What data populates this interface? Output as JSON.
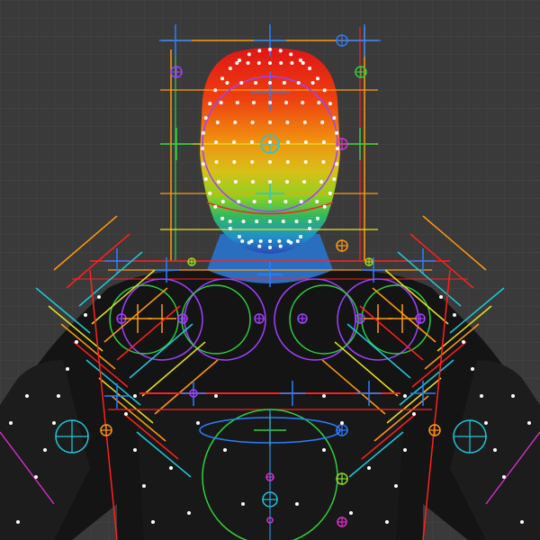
{
  "viewport": {
    "background": "#3a3a3a",
    "grid_color": "#474747",
    "body_color": "#141414",
    "head_gradient": [
      "#e01515",
      "#f06010",
      "#e8b010",
      "#b8d020",
      "#40c050",
      "#2090c8",
      "#2040b0"
    ],
    "vertex_color": "#ffffff",
    "control_colors": {
      "blue": "#2a7fff",
      "cyan": "#20c8d8",
      "orange": "#ff9a10",
      "yellow": "#e8e020",
      "red": "#ff2020",
      "green": "#30d040",
      "magenta": "#e030d0",
      "purple": "#a040ff",
      "lime": "#90e020"
    }
  }
}
